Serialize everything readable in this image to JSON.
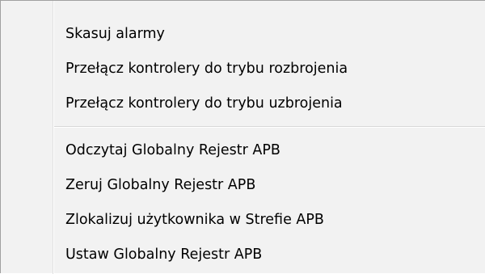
{
  "context_menu": {
    "group1": [
      {
        "label": "Skasuj alarmy"
      },
      {
        "label": "Przełącz kontrolery do trybu rozbrojenia"
      },
      {
        "label": "Przełącz kontrolery do trybu uzbrojenia"
      }
    ],
    "group2": [
      {
        "label": "Odczytaj Globalny Rejestr APB"
      },
      {
        "label": "Zeruj Globalny Rejestr APB"
      },
      {
        "label": "Zlokalizuj użytkownika w Strefie APB"
      },
      {
        "label": "Ustaw Globalny Rejestr APB"
      }
    ]
  }
}
